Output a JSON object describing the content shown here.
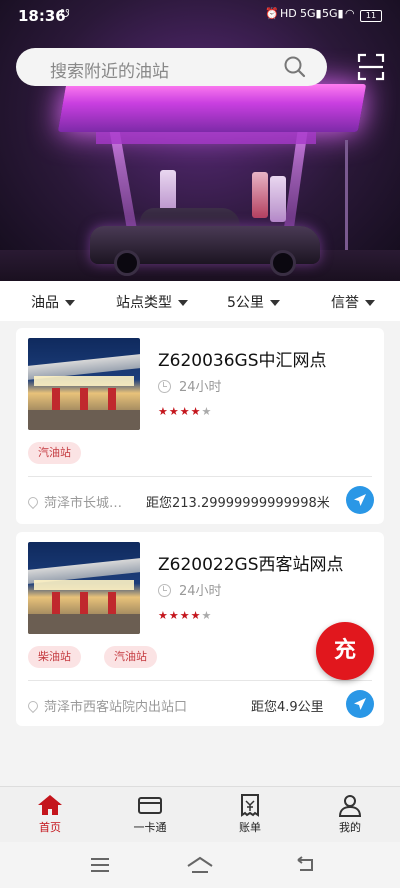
{
  "status_bar": {
    "time": "18:36",
    "battery": "11"
  },
  "search": {
    "placeholder": "搜索附近的油站"
  },
  "filters": [
    "油品",
    "站点类型",
    "5公里",
    "信誉"
  ],
  "stations": [
    {
      "name": "Z620036GS中汇网点",
      "hours": "24小时",
      "rating": 4,
      "tags": [
        "汽油站"
      ],
      "address": "菏泽市长城…",
      "distance": "距您213.29999999999998米"
    },
    {
      "name": "Z620022GS西客站网点",
      "hours": "24小时",
      "rating": 4,
      "tags": [
        "柴油站",
        "汽油站"
      ],
      "address": "菏泽市西客站院内出站口",
      "distance": "距您4.9公里"
    }
  ],
  "fab": {
    "label": "充"
  },
  "tabs": [
    {
      "label": "首页",
      "icon": "home-icon",
      "active": true
    },
    {
      "label": "一卡通",
      "icon": "card-icon"
    },
    {
      "label": "账单",
      "icon": "bill-icon"
    },
    {
      "label": "我的",
      "icon": "user-icon"
    }
  ],
  "colors": {
    "accent": "#c4151c",
    "nav_blue": "#2a97e6",
    "tag_bg": "#fbe3e4"
  }
}
